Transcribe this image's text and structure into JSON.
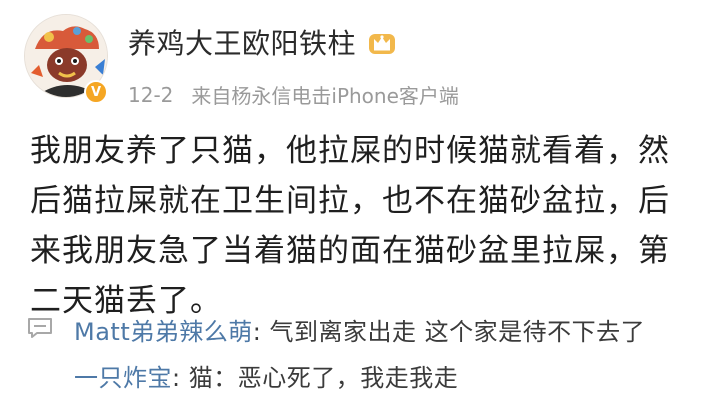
{
  "post": {
    "username": "养鸡大王欧阳铁柱",
    "date": "12-2",
    "source": "来自杨永信电击iPhone客户端",
    "content": "我朋友养了只猫，他拉屎的时候猫就看着，然后猫拉屎就在卫生间拉，也不在猫砂盆拉，后来我朋友急了当着猫的面在猫砂盆里拉屎，第二天猫丢了。"
  },
  "comments": [
    {
      "name": "Matt弟弟辣么萌",
      "separator": ":",
      "text": " 气到离家出走 这个家是待不下去了"
    },
    {
      "name": "一只炸宝",
      "separator": ":",
      "text": " 猫：恶心死了，我走我走"
    }
  ],
  "icons": {
    "avatar": "cartoon-avatar-icon",
    "verified": "verified-v-icon",
    "member": "crown-icon",
    "comment": "comment-bubble-icon"
  },
  "colors": {
    "username": "#2b2b2b",
    "meta": "#9a9a9a",
    "comment_name": "#4e79a7",
    "verified_badge": "#f5a623"
  }
}
